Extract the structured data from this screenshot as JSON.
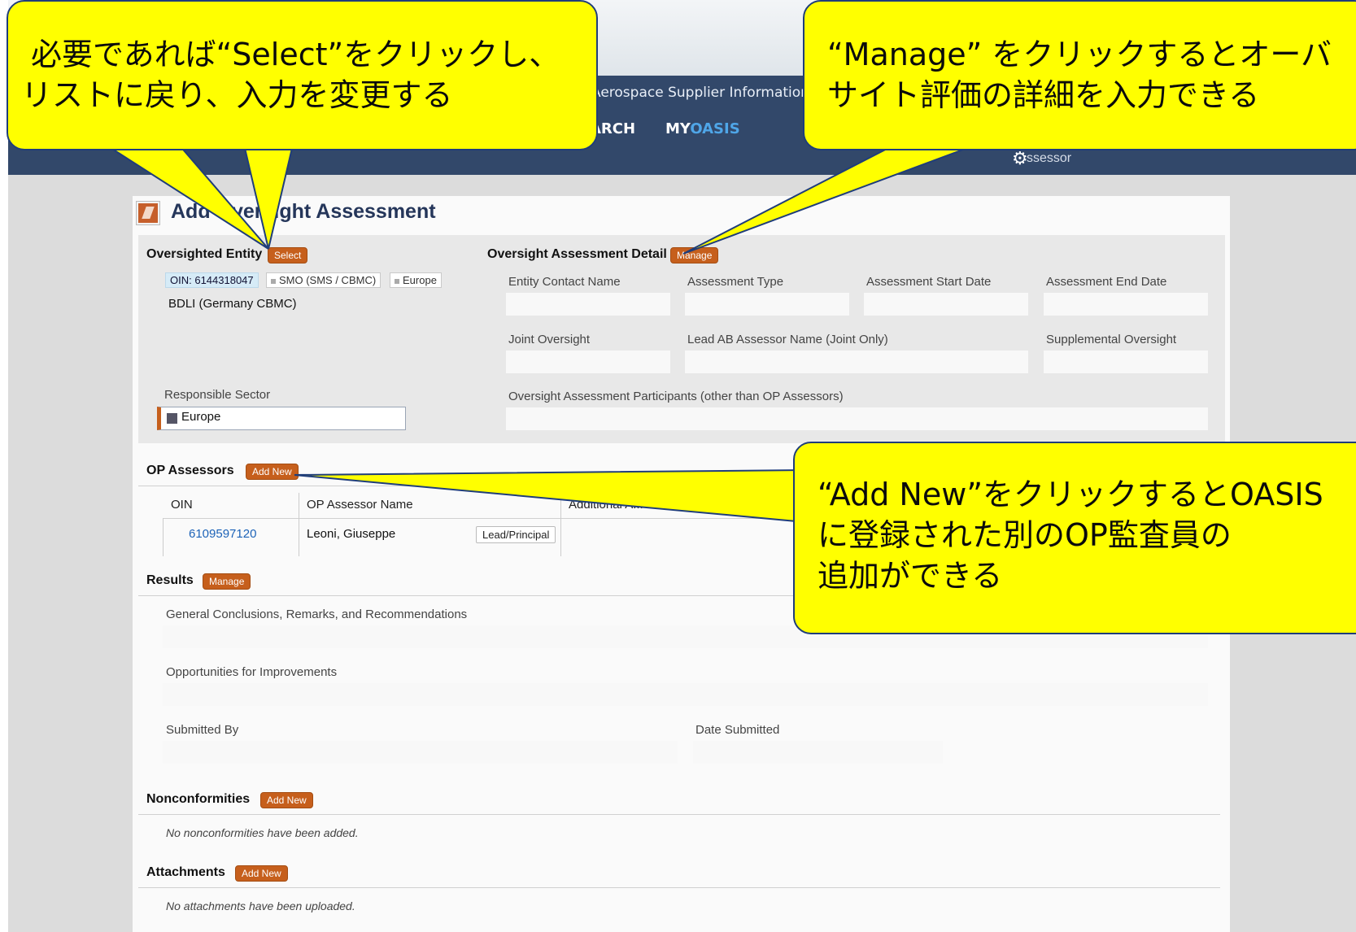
{
  "app": {
    "name": "Aerospace Supplier Information Sys",
    "nav_search": "ARCH",
    "nav_my": "MY",
    "nav_oasis": "OASIS",
    "user_role": "ssessor"
  },
  "page": {
    "title": "Add Oversight Assessment"
  },
  "entity": {
    "heading": "Oversighted Entity",
    "select_label": "Select",
    "oin_tag": "OIN: 6144318047",
    "type_tag": "SMO (SMS / CBMC)",
    "region_tag": "Europe",
    "name": "BDLI (Germany CBMC)",
    "sector_label": "Responsible Sector",
    "sector_value": "Europe"
  },
  "detail": {
    "heading": "Oversight Assessment Detail",
    "manage_label": "Manage",
    "labels": {
      "contact": "Entity Contact Name",
      "type": "Assessment Type",
      "start": "Assessment Start Date",
      "end": "Assessment End Date",
      "joint": "Joint Oversight",
      "lead": "Lead AB Assessor Name (Joint Only)",
      "supplemental": "Supplemental Oversight",
      "participants": "Oversight Assessment Participants (other than OP Assessors)"
    }
  },
  "assessors": {
    "heading": "OP Assessors",
    "add_label": "Add New",
    "columns": [
      "OIN",
      "OP Assessor Name",
      "Additional A..."
    ],
    "rows": [
      {
        "oin": "6109597120",
        "name": "Leoni, Giuseppe",
        "role": "Lead/Principal"
      }
    ]
  },
  "results": {
    "heading": "Results",
    "manage_label": "Manage",
    "conclusions_label": "General Conclusions, Remarks, and Recommendations",
    "improvements_label": "Opportunities for Improvements",
    "submitted_by_label": "Submitted By",
    "date_submitted_label": "Date Submitted"
  },
  "nonconformities": {
    "heading": "Nonconformities",
    "add_label": "Add New",
    "empty": "No nonconformities have been added."
  },
  "attachments": {
    "heading": "Attachments",
    "add_label": "Add New",
    "empty": "No attachments have been uploaded."
  },
  "callouts": {
    "select_line1": "必要であれば“Select”をクリックし、",
    "select_line2": "リストに戻り、入力を変更する",
    "manage_line1": "“Manage” をクリックするとオーバ",
    "manage_line2": "サイト評価の詳細を入力できる",
    "addnew_line1": "“Add New”をクリックするとOASIS",
    "addnew_line2": "に登録された別のOP監査員の",
    "addnew_line3": "追加ができる"
  },
  "colors": {
    "header": "#32486a",
    "accent": "#c65f1c",
    "callout": "#ffff00",
    "link": "#1d63b8"
  }
}
